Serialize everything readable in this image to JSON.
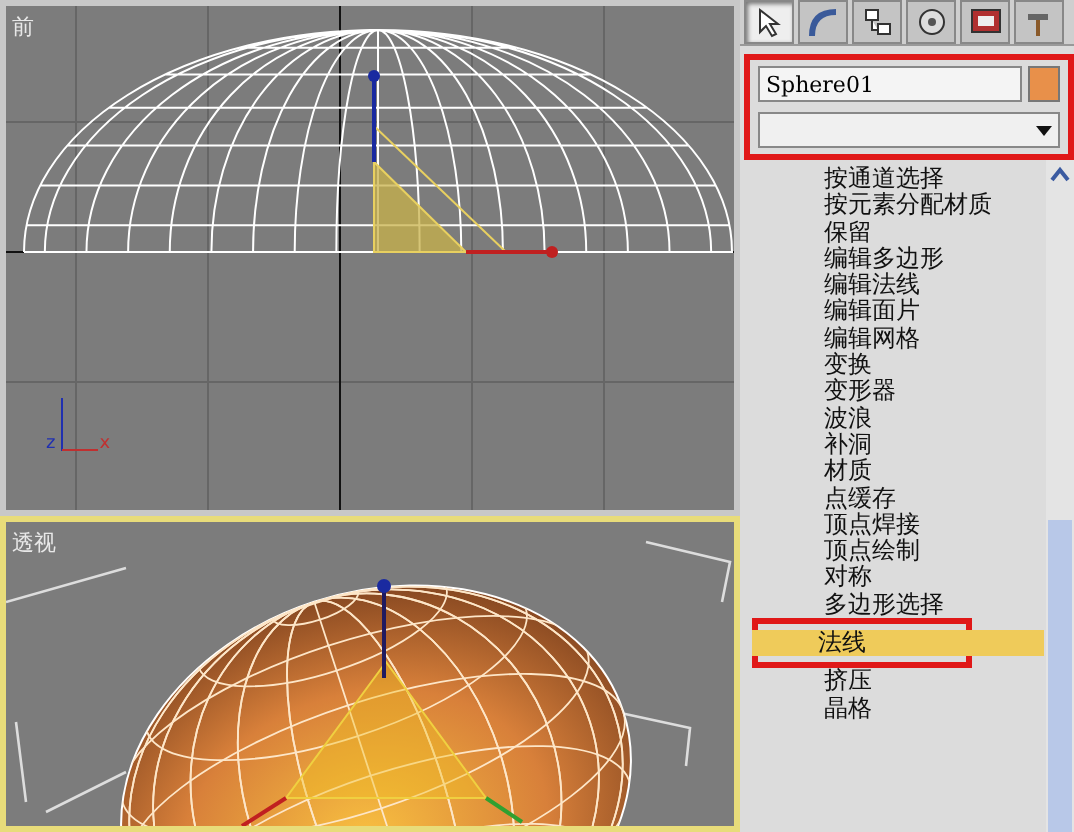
{
  "viewports": [
    {
      "kind": "front",
      "label": "前",
      "active": false,
      "axes": [
        "z",
        "x"
      ]
    },
    {
      "kind": "perspective",
      "label": "透视",
      "active": true
    }
  ],
  "command_panel": {
    "tabs": [
      {
        "selected": true
      },
      {
        "selected": false
      },
      {
        "selected": false
      },
      {
        "selected": false
      },
      {
        "selected": false
      },
      {
        "selected": false
      }
    ],
    "object": {
      "name": "Sphere01",
      "color": "#e8904a",
      "highlighted": true
    },
    "modifiers": [
      {
        "label": "按通道选择",
        "selected": false,
        "highlighted": false
      },
      {
        "label": "按元素分配材质",
        "selected": false,
        "highlighted": false
      },
      {
        "label": "保留",
        "selected": false,
        "highlighted": false
      },
      {
        "label": "编辑多边形",
        "selected": false,
        "highlighted": false
      },
      {
        "label": "编辑法线",
        "selected": false,
        "highlighted": false
      },
      {
        "label": "编辑面片",
        "selected": false,
        "highlighted": false
      },
      {
        "label": "编辑网格",
        "selected": false,
        "highlighted": false
      },
      {
        "label": "变换",
        "selected": false,
        "highlighted": false
      },
      {
        "label": "变形器",
        "selected": false,
        "highlighted": false
      },
      {
        "label": "波浪",
        "selected": false,
        "highlighted": false
      },
      {
        "label": "补洞",
        "selected": false,
        "highlighted": false
      },
      {
        "label": "材质",
        "selected": false,
        "highlighted": false
      },
      {
        "label": "点缓存",
        "selected": false,
        "highlighted": false
      },
      {
        "label": "顶点焊接",
        "selected": false,
        "highlighted": false
      },
      {
        "label": "顶点绘制",
        "selected": false,
        "highlighted": false
      },
      {
        "label": "对称",
        "selected": false,
        "highlighted": false
      },
      {
        "label": "多边形选择",
        "selected": false,
        "highlighted": false
      },
      {
        "label": "法线",
        "selected": true,
        "highlighted": true
      },
      {
        "label": "挤压",
        "selected": false,
        "highlighted": false
      },
      {
        "label": "晶格",
        "selected": false,
        "highlighted": false
      }
    ]
  }
}
